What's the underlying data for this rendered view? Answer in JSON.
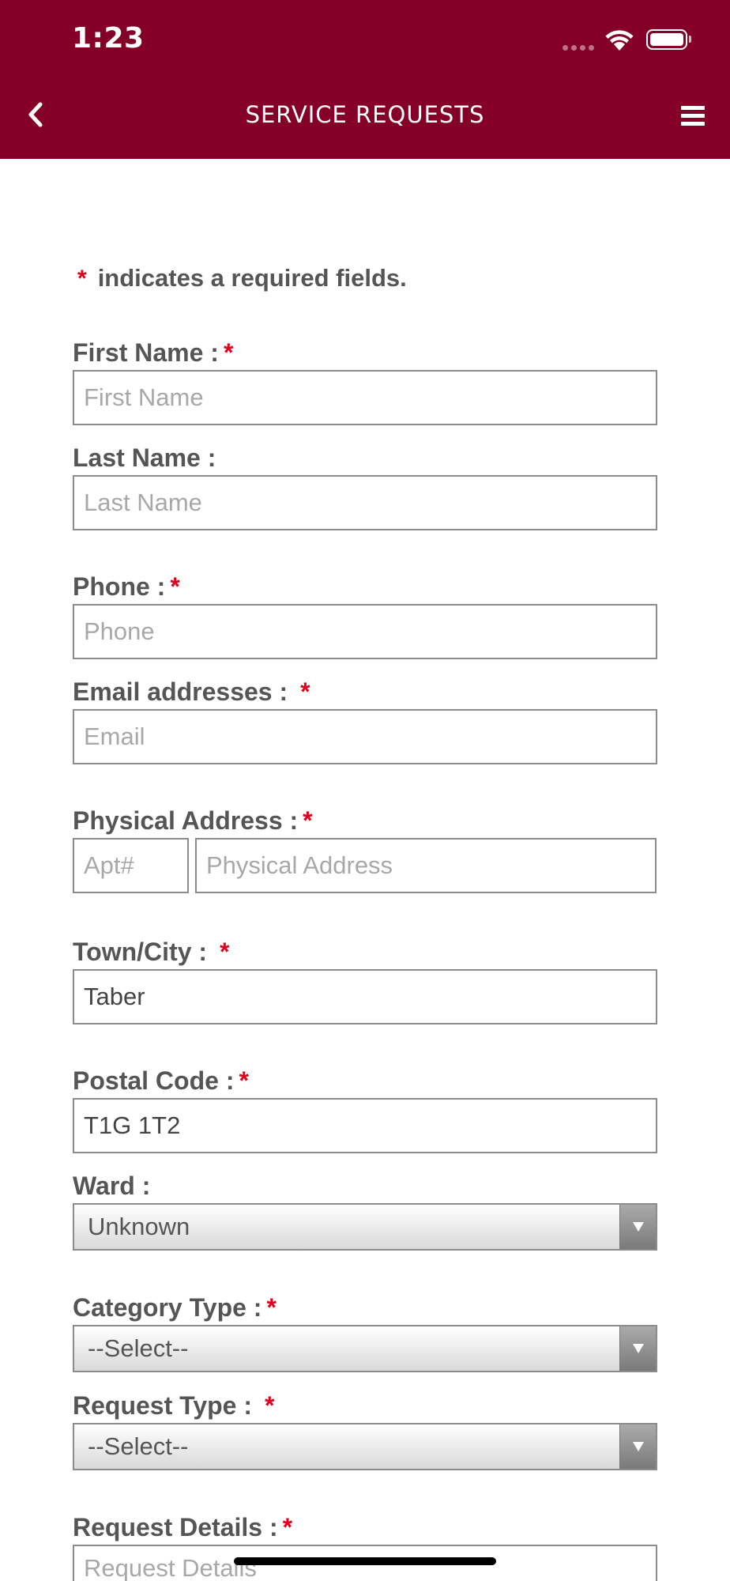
{
  "status_bar": {
    "time": "1:23"
  },
  "header": {
    "title": "SERVICE REQUESTS",
    "back_icon": "chevron-left-icon",
    "menu_icon": "hamburger-menu-icon",
    "background": "#850028"
  },
  "form": {
    "required_marker": "*",
    "legend": "indicates a required fields.",
    "first_name": {
      "label": "First Name :",
      "placeholder": "First Name",
      "value": ""
    },
    "last_name": {
      "label": "Last Name :",
      "placeholder": "Last Name",
      "value": ""
    },
    "phone": {
      "label": "Phone :",
      "placeholder": "Phone",
      "value": ""
    },
    "email": {
      "label": "Email addresses :",
      "placeholder": "Email",
      "value": ""
    },
    "physical_address": {
      "label": "Physical Address :",
      "apt_placeholder": "Apt#",
      "address_placeholder": "Physical Address"
    },
    "town_city": {
      "label": "Town/City :",
      "value": "Taber"
    },
    "postal_code": {
      "label": "Postal Code :",
      "value": "T1G 1T2"
    },
    "ward": {
      "label": "Ward :",
      "selected": "Unknown"
    },
    "category_type": {
      "label": "Category Type :",
      "selected": "--Select--"
    },
    "request_type": {
      "label": "Request Type :",
      "selected": "--Select--"
    },
    "request_details": {
      "label": "Request Details :",
      "placeholder": "Request Details"
    }
  }
}
